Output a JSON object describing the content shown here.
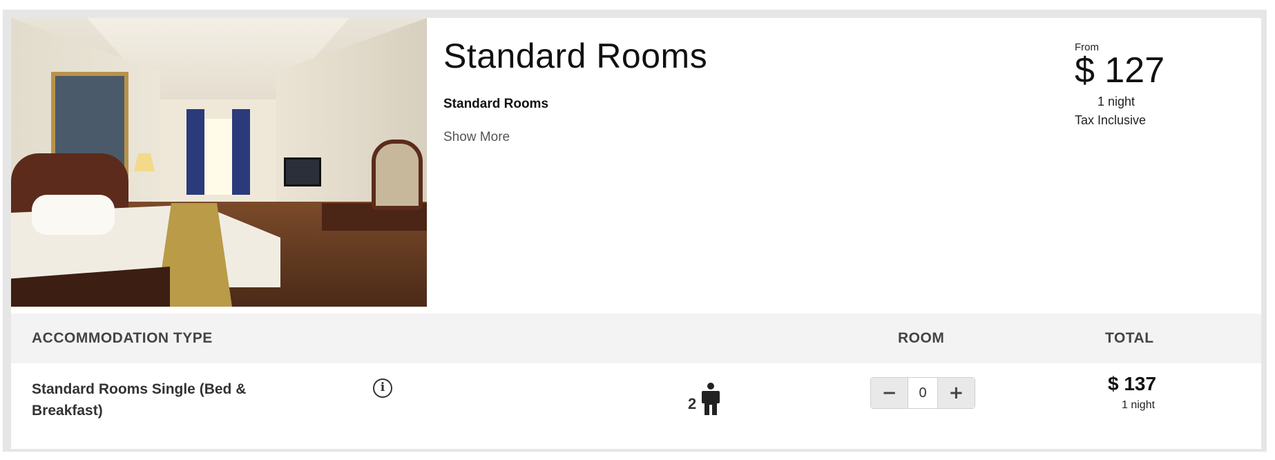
{
  "room": {
    "title": "Standard Rooms",
    "subtitle": "Standard Rooms",
    "show_more": "Show More",
    "photo_alt": "Standard room photo"
  },
  "price": {
    "from_label": "From",
    "amount": "$ 127",
    "nights": "1 night",
    "tax": "Tax Inclusive"
  },
  "table": {
    "headers": {
      "type": "ACCOMMODATION TYPE",
      "room": "ROOM",
      "total": "TOTAL"
    },
    "rows": [
      {
        "name": "Standard Rooms Single (Bed & Breakfast)",
        "info_icon": "info-icon",
        "occupancy": "2",
        "occupancy_icon": "person-icon",
        "minus_label": "−",
        "quantity": "0",
        "plus_label": "+",
        "total_amount": "$ 137",
        "total_nights": "1 night"
      }
    ]
  }
}
